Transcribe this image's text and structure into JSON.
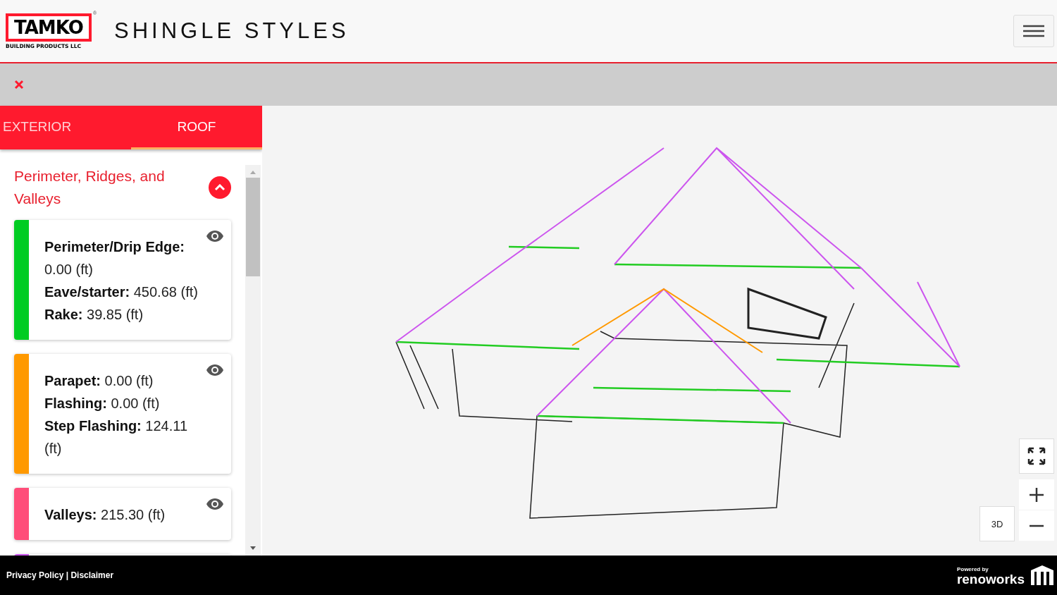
{
  "header": {
    "logo_text": "TAMKO",
    "logo_subtext": "BUILDING PRODUCTS LLC",
    "logo_mark": "®",
    "title": "SHINGLE STYLES"
  },
  "tabs": [
    {
      "label": "EXTERIOR",
      "selected": false
    },
    {
      "label": "ROOF",
      "selected": true
    }
  ],
  "section": {
    "title": "Perimeter, Ridges, and Valleys",
    "expanded": true
  },
  "cards": [
    {
      "color": "#00cc22",
      "lines": [
        "**Perimeter/Drip Edge:** 0.00 (ft)",
        "**Eave/starter:** 450.68 (ft)",
        "**Rake:** 39.85 (ft)"
      ]
    },
    {
      "color": "#ff9900",
      "lines": [
        "**Parapet:** 0.00 (ft)",
        "**Flashing:** 0.00 (ft)",
        "**Step Flashing:** 124.11 (ft)"
      ]
    },
    {
      "color": "#ff4d79",
      "lines": [
        "**Valleys:** 215.30 (ft)"
      ]
    },
    {
      "color": "#cc55ee"
    }
  ],
  "footer": {
    "links": "Privacy Policy | Disclaimer",
    "powered_by": "Powered by",
    "brand": "renoworks"
  },
  "viewer": {
    "rotate_label": "3D"
  }
}
